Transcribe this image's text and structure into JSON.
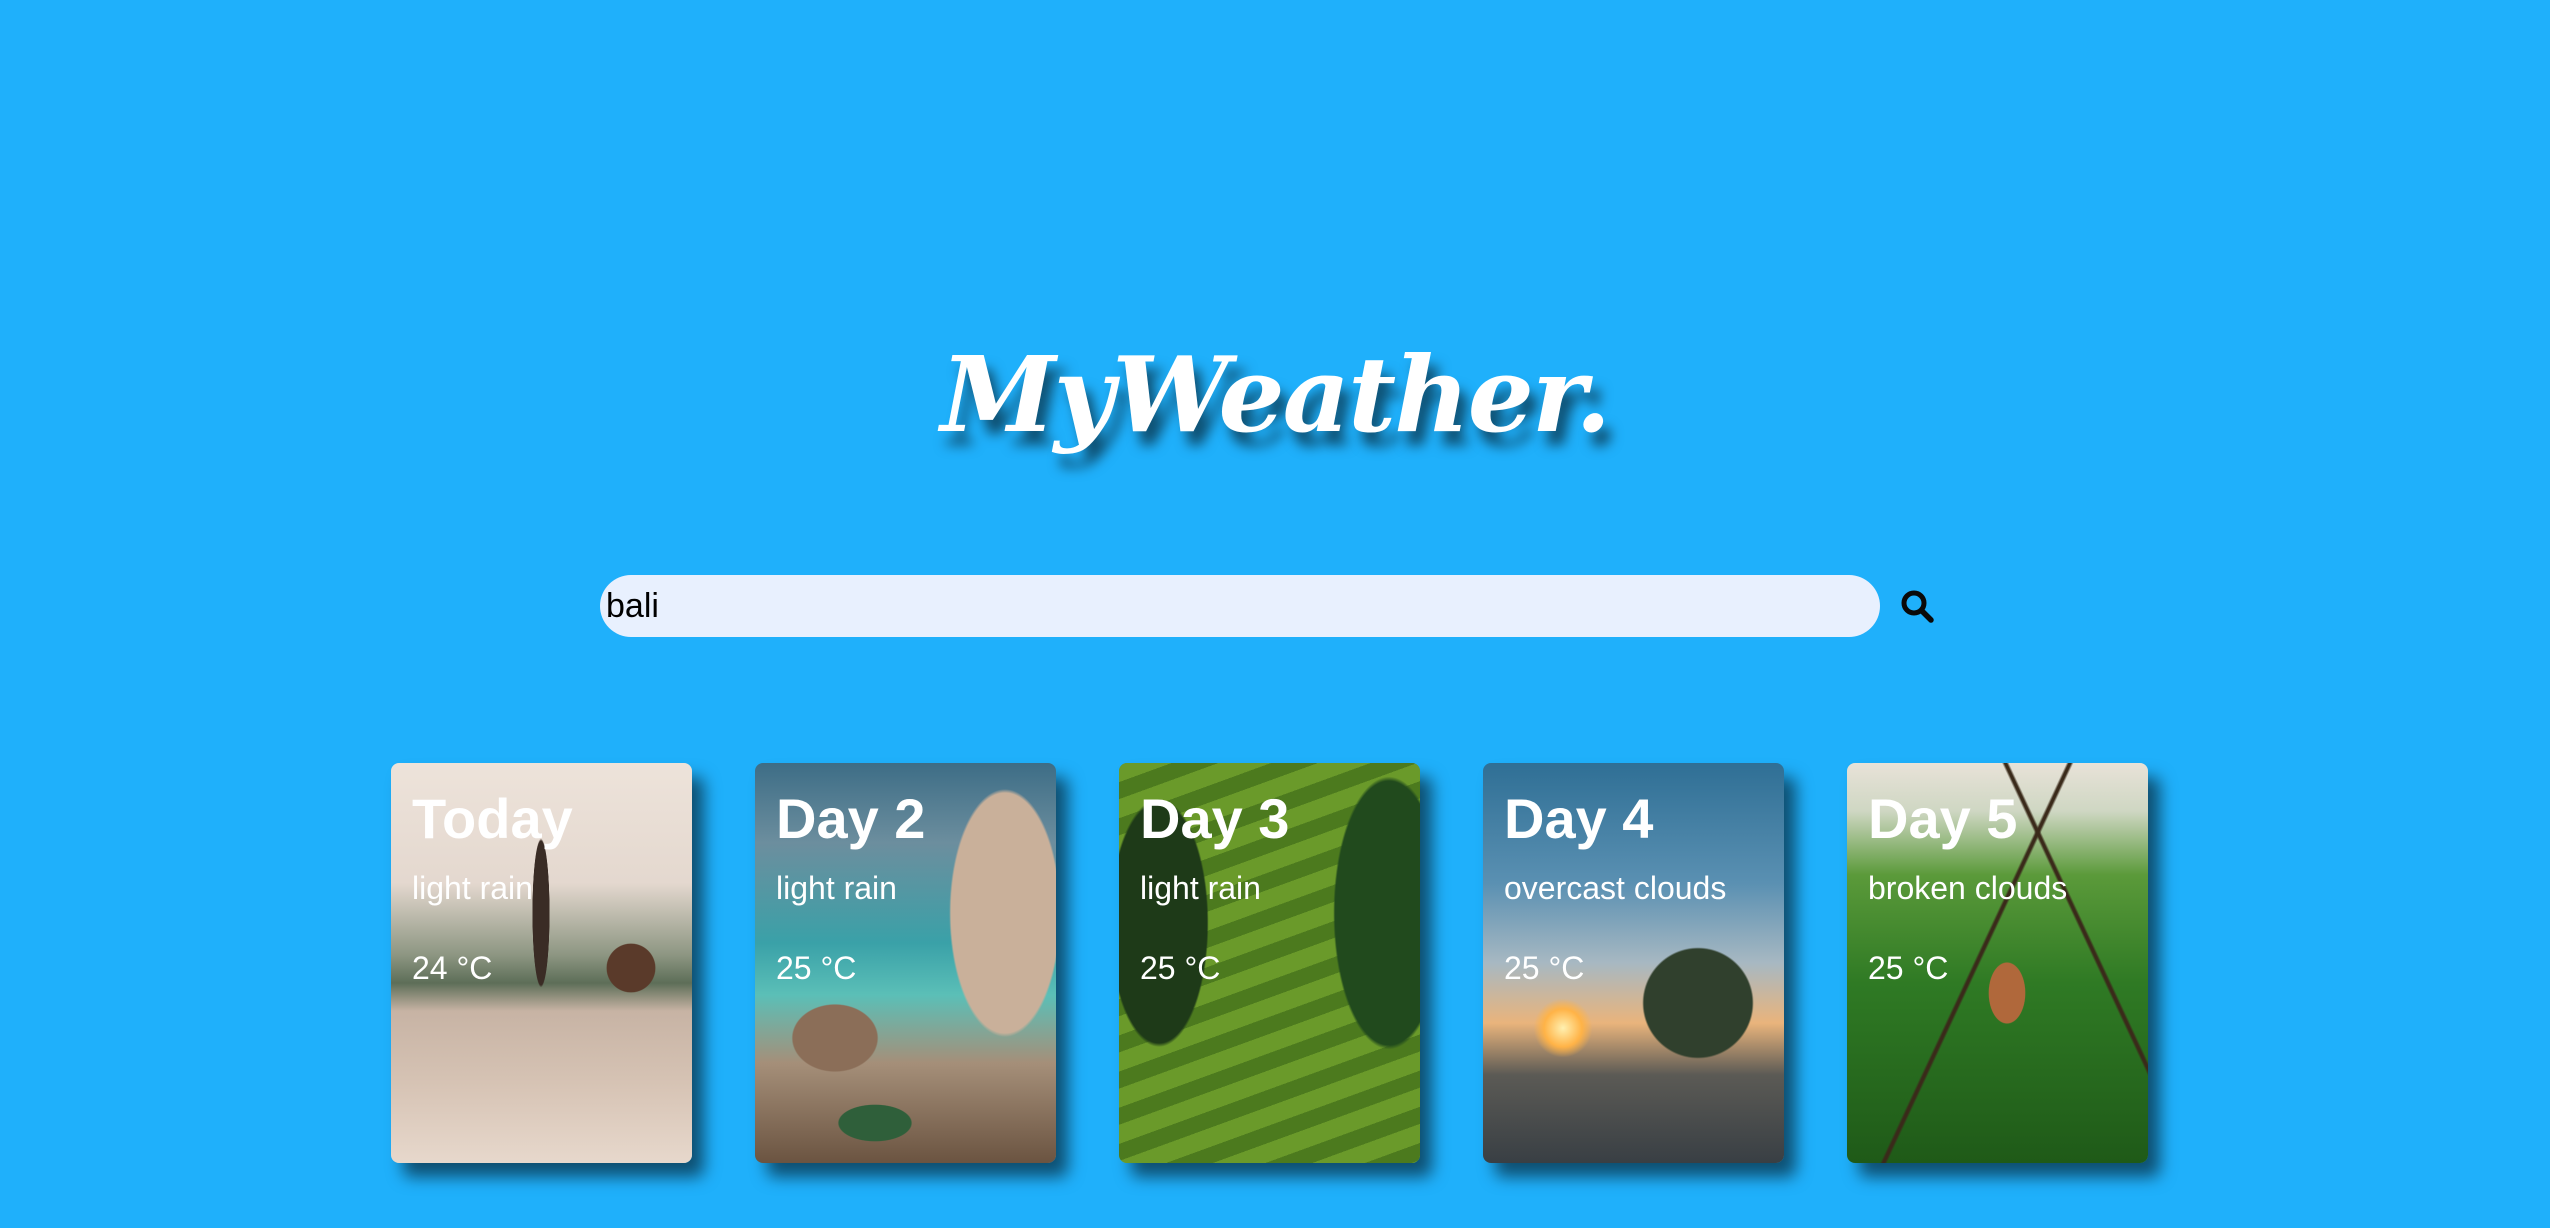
{
  "app": {
    "logo": "MyWeather."
  },
  "search": {
    "value": "bali",
    "button_icon": "search-icon"
  },
  "forecast": [
    {
      "title": "Today",
      "description": "light rain",
      "temp": "24 °C"
    },
    {
      "title": "Day 2",
      "description": "light rain",
      "temp": "25 °C"
    },
    {
      "title": "Day 3",
      "description": "light rain",
      "temp": "25 °C"
    },
    {
      "title": "Day 4",
      "description": "overcast clouds",
      "temp": "25 °C"
    },
    {
      "title": "Day 5",
      "description": "broken clouds",
      "temp": "25 °C"
    }
  ],
  "colors": {
    "background": "#1fb0fb",
    "input_background": "#e8f0fe",
    "text": "#ffffff"
  }
}
